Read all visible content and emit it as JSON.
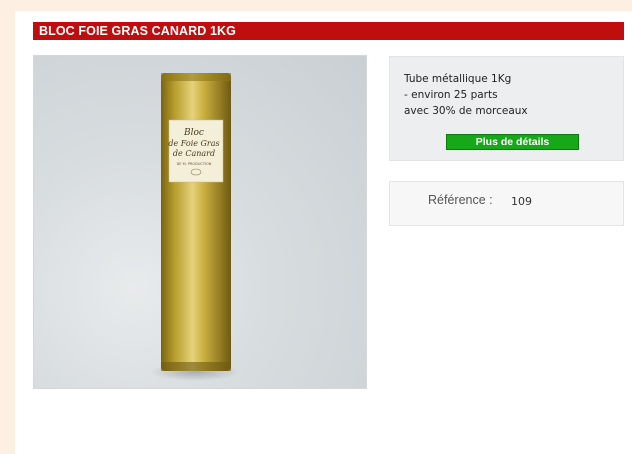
{
  "product": {
    "title": "BLOC FOIE GRAS CANARD 1KG",
    "image": {
      "label_lines": [
        "Bloc",
        "de Foie Gras",
        "de Canard"
      ],
      "small_print": "DE M. PRODUCTION"
    },
    "description_lines": [
      "Tube métallique 1Kg",
      "- environ 25 parts",
      "avec 30% de morceaux"
    ],
    "details_button_label": "Plus de détails",
    "reference_label": "Référence :",
    "reference_value": "109"
  },
  "colors": {
    "title_bar": "#c00d0d",
    "details_button": "#17a81a",
    "page_background": "#fdf0e3"
  }
}
